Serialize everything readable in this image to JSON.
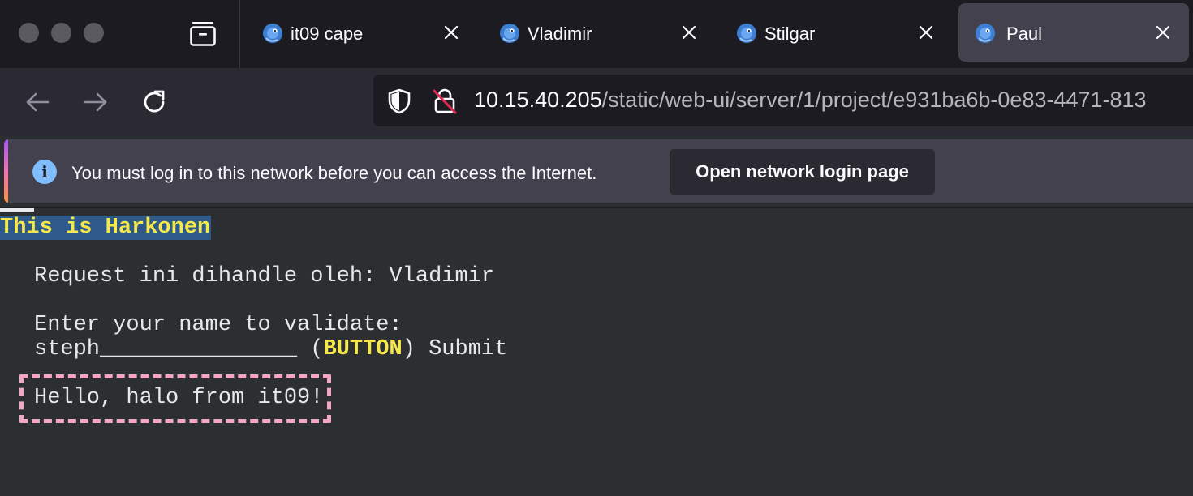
{
  "tabs": [
    {
      "title": "it09 cape",
      "active": false
    },
    {
      "title": "Vladimir",
      "active": false
    },
    {
      "title": "Stilgar",
      "active": false
    },
    {
      "title": "Paul",
      "active": true
    }
  ],
  "address_bar": {
    "host": "10.15.40.205",
    "path": "/static/web-ui/server/1/project/e931ba6b-0e83-4471-813"
  },
  "notification": {
    "message": "You must log in to this network before you can access the Internet.",
    "button_label": "Open network login page"
  },
  "page": {
    "title": "This is Harkonen",
    "handler_line": "Request ini dihandle oleh: Vladimir",
    "prompt": "Enter your name to validate:",
    "name_field": "steph_______________",
    "button_open": " (",
    "button_tag": "BUTTON",
    "button_close": ") ",
    "button_label": "Submit",
    "greeting": "Hello, halo from it09!"
  },
  "colors": {
    "tab_strip": "#1c1b22",
    "toolbar": "#2b2a33",
    "page_background": "#2b2f31",
    "title_highlight": "#2d5a8a",
    "title_text": "#f6e84a",
    "greeting_border": "#f4a7c4"
  },
  "icons": {
    "tab_overview": "tab-overview-icon",
    "tab_favicon": "chameleon-icon",
    "back": "back-arrow-icon",
    "forward": "forward-arrow-icon",
    "reload": "reload-icon",
    "tracking": "shield-icon",
    "insecure": "insecure-lock-icon",
    "info": "info-icon"
  }
}
